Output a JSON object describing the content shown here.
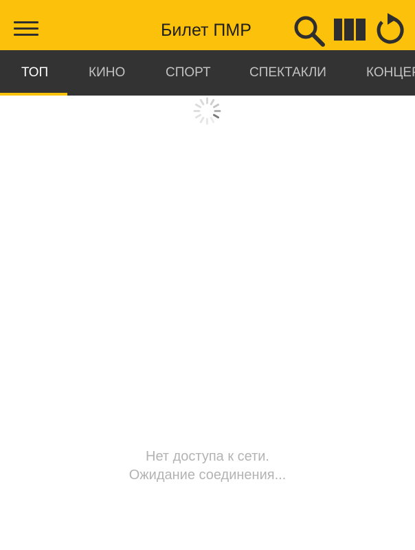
{
  "app": {
    "title": "Билет ПМР"
  },
  "toolbar": {
    "menu_icon": "hamburger-menu-icon",
    "search_icon": "search-icon",
    "layout_icon": "view-columns-icon",
    "refresh_icon": "refresh-icon"
  },
  "tabs": [
    {
      "label": "ТОП",
      "active": true
    },
    {
      "label": "КИНО",
      "active": false
    },
    {
      "label": "СПОРТ",
      "active": false
    },
    {
      "label": "СПЕКТАКЛИ",
      "active": false
    },
    {
      "label": "КОНЦЕР",
      "active": false
    }
  ],
  "status": {
    "line1": "Нет доступа к сети.",
    "line2": "Ожидание соединения..."
  },
  "colors": {
    "accent": "#fcc10a",
    "tab_bar": "#333333",
    "icon": "#2e2e2e",
    "status_text": "#b3b3b3"
  }
}
